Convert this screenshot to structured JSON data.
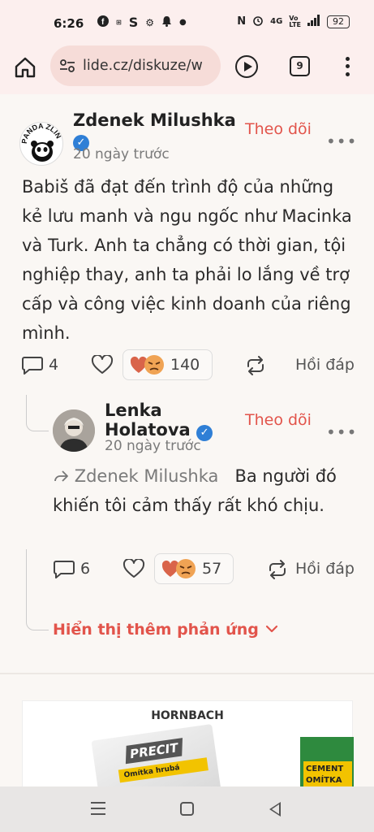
{
  "status_bar": {
    "time": "6:26",
    "battery": "92",
    "left_icons": [
      "facebook-icon",
      "temu-icon",
      "s-icon",
      "app-icon",
      "bell-icon",
      "dot-icon"
    ],
    "right_icons": [
      "nfc-icon",
      "alarm-icon",
      "signal-icon",
      "volte-icon",
      "signal-bars-icon"
    ]
  },
  "browser": {
    "url": "lide.cz/diskuze/w",
    "tab_count": "9"
  },
  "comments": [
    {
      "author": "Zdenek Milushka",
      "time": "20 ngày trước",
      "follow_label": "Theo dõi",
      "text": "Babiš đã đạt đến trình độ của những kẻ lưu manh và ngu ngốc như Macinka và Turk. Anh ta chẳng có thời gian, tội nghiệp thay, anh ta phải lo lắng về trợ cấp và công việc kinh doanh của riêng mình.",
      "comment_count": "4",
      "reaction_count": "140",
      "reply_label": "Hồi đáp",
      "avatar_text": "PANDA ZLÍN"
    },
    {
      "author": "Lenka Holatova",
      "time": "20 ngày trước",
      "follow_label": "Theo dõi",
      "reply_to": "Zdenek Milushka",
      "text": "Ba người đó khiến tôi cảm thấy rất khó chịu.",
      "comment_count": "6",
      "reaction_count": "57",
      "reply_label": "Hồi đáp"
    }
  ],
  "show_more_label": "Hiển thị thêm phản ứng",
  "ad": {
    "title": "HORNBACH",
    "product1_brand": "PRECIT",
    "product1_label": "Omítka hrubá",
    "product2_label": "CEMENT OMÍTKA"
  },
  "colors": {
    "accent": "#e2544b",
    "verified": "#2f7fd6",
    "chrome_bg": "#fcefee"
  }
}
